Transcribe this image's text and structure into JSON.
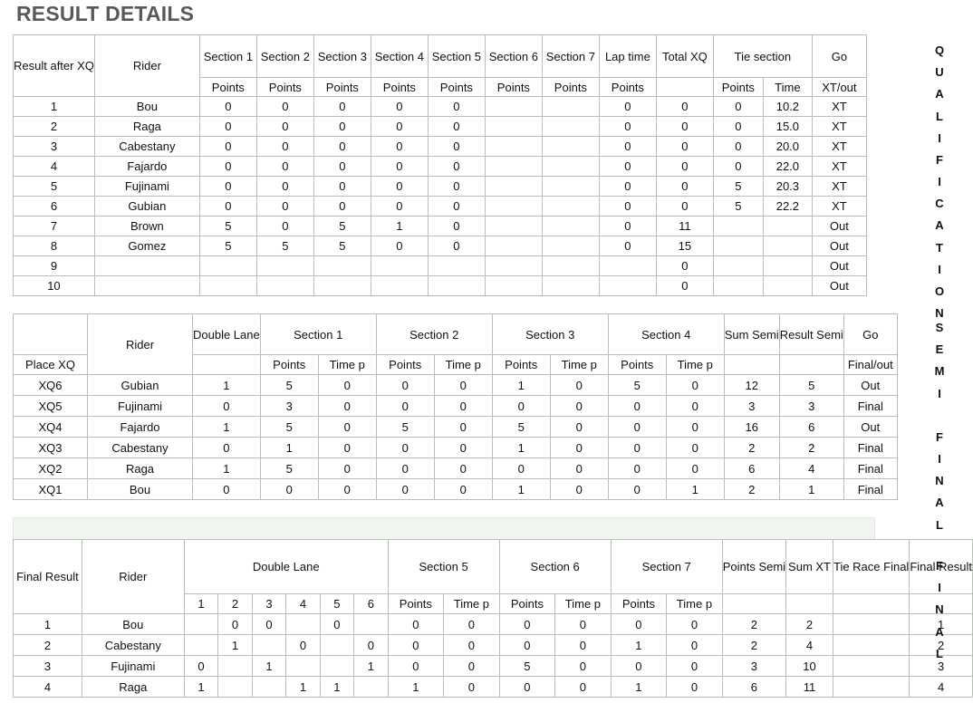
{
  "page": {
    "title": "RESULT DETAILS",
    "accent_header": "#e2e6de",
    "accent_band": "#f0f5ef"
  },
  "side_labels": [
    {
      "name": "qualification",
      "text": "QUALIFICATION"
    },
    {
      "name": "semi-final",
      "text": "SEMI FINAL"
    },
    {
      "name": "final",
      "text": "FINAL"
    }
  ],
  "qualification": {
    "group_headers": [
      "Result after XQ",
      "Rider",
      "Section 1",
      "Section 2",
      "Section 3",
      "Section 4",
      "Section 5",
      "Section 6",
      "Section 7",
      "Lap time",
      "Total XQ",
      "Tie section",
      "Go"
    ],
    "sub_headers": [
      "",
      "",
      "Points",
      "Points",
      "Points",
      "Points",
      "Points",
      "Points",
      "Points",
      "Points",
      "",
      "Points",
      "Time",
      "XT/out"
    ],
    "rows": [
      {
        "rank": "1",
        "rider": "Bou",
        "s1": "0",
        "s2": "0",
        "s3": "0",
        "s4": "0",
        "s5": "0",
        "s6": "",
        "s7": "",
        "lap": "0",
        "total": "0",
        "tie_points": "0",
        "tie_time": "10.2",
        "go": "XT"
      },
      {
        "rank": "2",
        "rider": "Raga",
        "s1": "0",
        "s2": "0",
        "s3": "0",
        "s4": "0",
        "s5": "0",
        "s6": "",
        "s7": "",
        "lap": "0",
        "total": "0",
        "tie_points": "0",
        "tie_time": "15.0",
        "go": "XT"
      },
      {
        "rank": "3",
        "rider": "Cabestany",
        "s1": "0",
        "s2": "0",
        "s3": "0",
        "s4": "0",
        "s5": "0",
        "s6": "",
        "s7": "",
        "lap": "0",
        "total": "0",
        "tie_points": "0",
        "tie_time": "20.0",
        "go": "XT"
      },
      {
        "rank": "4",
        "rider": "Fajardo",
        "s1": "0",
        "s2": "0",
        "s3": "0",
        "s4": "0",
        "s5": "0",
        "s6": "",
        "s7": "",
        "lap": "0",
        "total": "0",
        "tie_points": "0",
        "tie_time": "22.0",
        "go": "XT"
      },
      {
        "rank": "5",
        "rider": "Fujinami",
        "s1": "0",
        "s2": "0",
        "s3": "0",
        "s4": "0",
        "s5": "0",
        "s6": "",
        "s7": "",
        "lap": "0",
        "total": "0",
        "tie_points": "5",
        "tie_time": "20.3",
        "go": "XT"
      },
      {
        "rank": "6",
        "rider": "Gubian",
        "s1": "0",
        "s2": "0",
        "s3": "0",
        "s4": "0",
        "s5": "0",
        "s6": "",
        "s7": "",
        "lap": "0",
        "total": "0",
        "tie_points": "5",
        "tie_time": "22.2",
        "go": "XT"
      },
      {
        "rank": "7",
        "rider": "Brown",
        "s1": "5",
        "s2": "0",
        "s3": "5",
        "s4": "1",
        "s5": "0",
        "s6": "",
        "s7": "",
        "lap": "0",
        "total": "11",
        "tie_points": "",
        "tie_time": "",
        "go": "Out"
      },
      {
        "rank": "8",
        "rider": "Gomez",
        "s1": "5",
        "s2": "5",
        "s3": "5",
        "s4": "0",
        "s5": "0",
        "s6": "",
        "s7": "",
        "lap": "0",
        "total": "15",
        "tie_points": "",
        "tie_time": "",
        "go": "Out"
      },
      {
        "rank": "9",
        "rider": "",
        "s1": "",
        "s2": "",
        "s3": "",
        "s4": "",
        "s5": "",
        "s6": "",
        "s7": "",
        "lap": "",
        "total": "0",
        "tie_points": "",
        "tie_time": "",
        "go": "Out"
      },
      {
        "rank": "10",
        "rider": "",
        "s1": "",
        "s2": "",
        "s3": "",
        "s4": "",
        "s5": "",
        "s6": "",
        "s7": "",
        "lap": "",
        "total": "0",
        "tie_points": "",
        "tie_time": "",
        "go": "Out"
      }
    ]
  },
  "semi": {
    "group_headers": [
      "",
      "Rider",
      "Double Lane",
      "Section 1",
      "Section 2",
      "Section 3",
      "Section 4",
      "Sum Semi",
      "Result Semi",
      "Go"
    ],
    "sub_headers": [
      "Place XQ",
      "",
      "",
      "Points",
      "Time p",
      "Points",
      "Time p",
      "Points",
      "Time p",
      "Points",
      "Time p",
      "",
      "",
      "Final/out"
    ],
    "rows": [
      {
        "place": "XQ6",
        "rider": "Gubian",
        "lane": "1",
        "shade": "sh1",
        "s1p": "5",
        "s1t": "0",
        "s2p": "0",
        "s2t": "0",
        "s3p": "1",
        "s3t": "0",
        "s4p": "5",
        "s4t": "0",
        "sum": "12",
        "result": "5",
        "go": "Out"
      },
      {
        "place": "XQ5",
        "rider": "Fujinami",
        "lane": "0",
        "shade": "sh1",
        "s1p": "3",
        "s1t": "0",
        "s2p": "0",
        "s2t": "0",
        "s3p": "0",
        "s3t": "0",
        "s4p": "0",
        "s4t": "0",
        "sum": "3",
        "result": "3",
        "go": "Final"
      },
      {
        "place": "XQ4",
        "rider": "Fajardo",
        "lane": "1",
        "shade": "sh2",
        "s1p": "5",
        "s1t": "0",
        "s2p": "5",
        "s2t": "0",
        "s3p": "5",
        "s3t": "0",
        "s4p": "0",
        "s4t": "0",
        "sum": "16",
        "result": "6",
        "go": "Out"
      },
      {
        "place": "XQ3",
        "rider": "Cabestany",
        "lane": "0",
        "shade": "sh2",
        "s1p": "1",
        "s1t": "0",
        "s2p": "0",
        "s2t": "0",
        "s3p": "1",
        "s3t": "0",
        "s4p": "0",
        "s4t": "0",
        "sum": "2",
        "result": "2",
        "go": "Final"
      },
      {
        "place": "XQ2",
        "rider": "Raga",
        "lane": "1",
        "shade": "sh3",
        "s1p": "5",
        "s1t": "0",
        "s2p": "0",
        "s2t": "0",
        "s3p": "0",
        "s3t": "0",
        "s4p": "0",
        "s4t": "0",
        "sum": "6",
        "result": "4",
        "go": "Final"
      },
      {
        "place": "XQ1",
        "rider": "Bou",
        "lane": "0",
        "shade": "sh3",
        "s1p": "0",
        "s1t": "0",
        "s2p": "0",
        "s2t": "0",
        "s3p": "1",
        "s3t": "0",
        "s4p": "0",
        "s4t": "1",
        "sum": "2",
        "result": "1",
        "go": "Final"
      }
    ]
  },
  "final": {
    "group_headers": [
      "Final Result",
      "Rider",
      "Double Lane",
      "Section 5",
      "Section 6",
      "Section 7",
      "Points Semi",
      "Sum XT",
      "Tie Race Final",
      "Final Result"
    ],
    "sub_headers": [
      "",
      "",
      "1",
      "2",
      "3",
      "4",
      "5",
      "6",
      "Points",
      "Time p",
      "Points",
      "Time p",
      "Points",
      "Time p",
      "",
      "",
      "",
      ""
    ],
    "rows": [
      {
        "rank": "1",
        "rider": "Bou",
        "l1": "",
        "l2": "0",
        "l3": "0",
        "l4": "",
        "l5": "0",
        "l6": "",
        "s5p": "0",
        "s5t": "0",
        "s6p": "0",
        "s6t": "0",
        "s7p": "0",
        "s7t": "0",
        "pts_semi": "2",
        "sum_xt": "2",
        "tie": "",
        "final": "1"
      },
      {
        "rank": "2",
        "rider": "Cabestany",
        "l1": "",
        "l2": "1",
        "l3": "",
        "l4": "0",
        "l5": "",
        "l6": "0",
        "s5p": "0",
        "s5t": "0",
        "s6p": "0",
        "s6t": "0",
        "s7p": "1",
        "s7t": "0",
        "pts_semi": "2",
        "sum_xt": "4",
        "tie": "",
        "final": "2"
      },
      {
        "rank": "3",
        "rider": "Fujinami",
        "l1": "0",
        "l2": "",
        "l3": "1",
        "l4": "",
        "l5": "",
        "l6": "1",
        "s5p": "0",
        "s5t": "0",
        "s6p": "5",
        "s6t": "0",
        "s7p": "0",
        "s7t": "0",
        "pts_semi": "3",
        "sum_xt": "10",
        "tie": "",
        "final": "3"
      },
      {
        "rank": "4",
        "rider": "Raga",
        "l1": "1",
        "l2": "",
        "l3": "",
        "l4": "1",
        "l5": "1",
        "l6": "",
        "s5p": "1",
        "s5t": "0",
        "s6p": "0",
        "s6t": "0",
        "s7p": "1",
        "s7t": "0",
        "pts_semi": "6",
        "sum_xt": "11",
        "tie": "",
        "final": "4"
      }
    ]
  }
}
